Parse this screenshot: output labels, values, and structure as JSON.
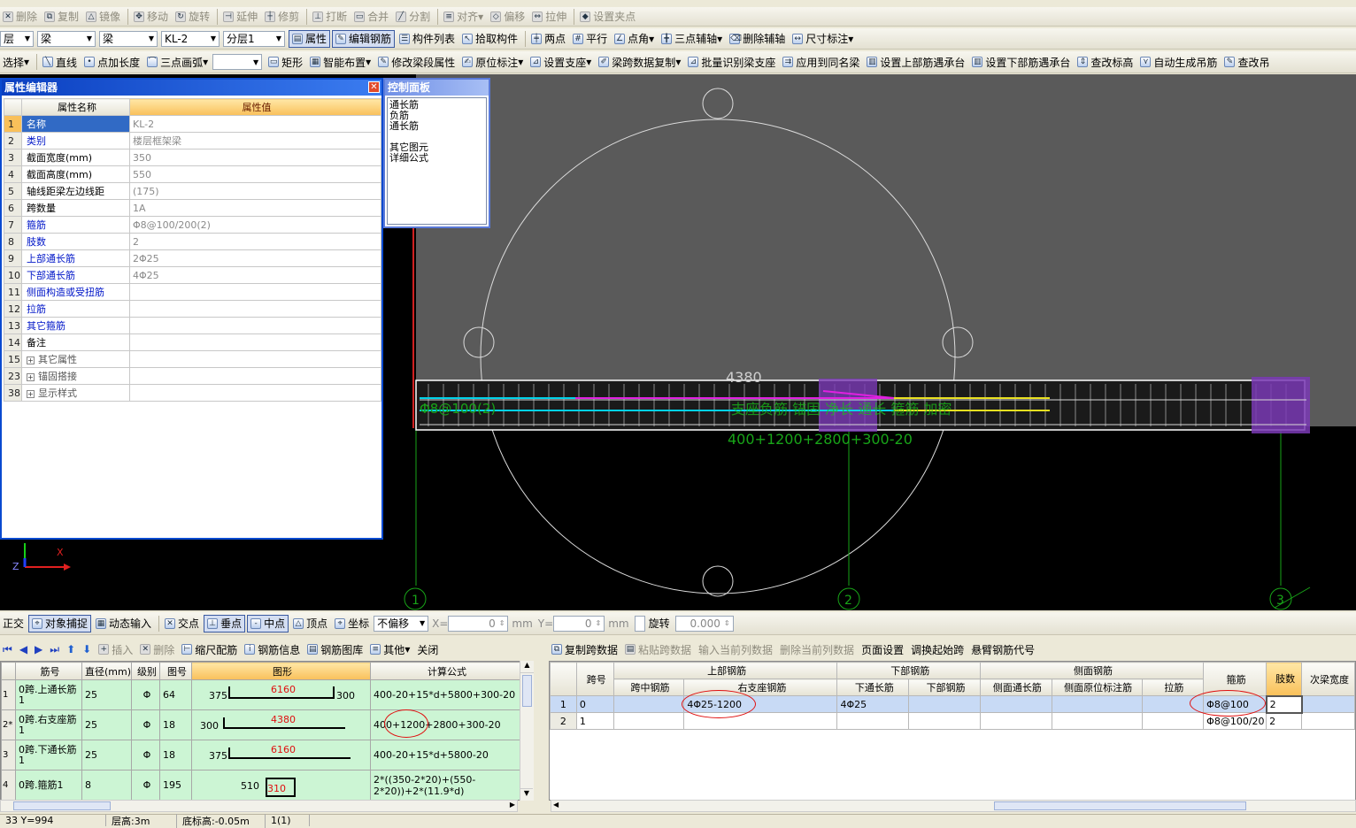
{
  "toolbar1": {
    "items": [
      "删除",
      "复制",
      "镜像",
      "移动",
      "旋转",
      "延伸",
      "修剪",
      "打断",
      "合并",
      "分割",
      "对齐",
      "偏移",
      "拉伸",
      "设置夹点"
    ]
  },
  "toolbar2": {
    "floor_combo": "层",
    "type_combo1": "梁",
    "type_combo2": "梁",
    "element_combo": "KL-2",
    "layer_combo": "分层1",
    "items": [
      "属性",
      "编辑钢筋",
      "构件列表",
      "拾取构件",
      "两点",
      "平行",
      "点角",
      "三点辅轴",
      "删除辅轴",
      "尺寸标注"
    ]
  },
  "toolbar3": {
    "select_label": "选择",
    "items": [
      "直线",
      "点加长度",
      "三点画弧",
      "矩形",
      "智能布置",
      "修改梁段属性",
      "原位标注",
      "设置支座",
      "梁跨数据复制",
      "批量识别梁支座",
      "应用到同名梁",
      "设置上部筋遇承台",
      "设置下部筋遇承台",
      "查改标高",
      "自动生成吊筋",
      "查改吊"
    ]
  },
  "property_editor": {
    "title": "属性编辑器",
    "col_name": "属性名称",
    "col_value": "属性值",
    "rows": [
      {
        "num": "1",
        "name": "名称",
        "value": "KL-2"
      },
      {
        "num": "2",
        "name": "类别",
        "value": "楼层框架梁"
      },
      {
        "num": "3",
        "name": "截面宽度(mm)",
        "value": "350"
      },
      {
        "num": "4",
        "name": "截面高度(mm)",
        "value": "550"
      },
      {
        "num": "5",
        "name": "轴线距梁左边线距",
        "value": "(175)"
      },
      {
        "num": "6",
        "name": "跨数量",
        "value": "1A"
      },
      {
        "num": "7",
        "name": "箍筋",
        "value": "Φ8@100/200(2)"
      },
      {
        "num": "8",
        "name": "肢数",
        "value": "2"
      },
      {
        "num": "9",
        "name": "上部通长筋",
        "value": "2Φ25"
      },
      {
        "num": "10",
        "name": "下部通长筋",
        "value": "4Φ25"
      },
      {
        "num": "11",
        "name": "侧面构造或受扭筋",
        "value": ""
      },
      {
        "num": "12",
        "name": "拉筋",
        "value": ""
      },
      {
        "num": "13",
        "name": "其它箍筋",
        "value": ""
      },
      {
        "num": "14",
        "name": "备注",
        "value": ""
      },
      {
        "num": "15",
        "name": "其它属性",
        "value": ""
      },
      {
        "num": "23",
        "name": "锚固搭接",
        "value": ""
      },
      {
        "num": "38",
        "name": "显示样式",
        "value": ""
      }
    ]
  },
  "control_panel": {
    "title": "控制面板",
    "lines": [
      "通长筋",
      "负筋",
      "通长筋",
      "",
      "其它图元",
      "详细公式"
    ]
  },
  "canvas": {
    "dim_top": "4380",
    "left_label": "Φ8@100(2)",
    "overlay_text": "支座负筋 锚固 净长 通长 箍筋 加密",
    "formula_text": "400+1200+2800+300-20",
    "axis_labels": [
      "1",
      "2",
      "3"
    ],
    "axes": {
      "x": "X",
      "y": "Y",
      "z": "Z"
    }
  },
  "snapbar": {
    "items": [
      "正交",
      "对象捕捉",
      "动态输入",
      "交点",
      "垂点",
      "中点",
      "顶点",
      "坐标"
    ],
    "offset_combo": "不偏移",
    "x_label": "X=",
    "x_value": "0",
    "y_label": "Y=",
    "y_value": "0",
    "unit": "mm",
    "rotate_label": "旋转",
    "rotate_value": "0.000"
  },
  "rebar_toolbar": {
    "items": [
      "插入",
      "删除",
      "缩尺配筋",
      "钢筋信息",
      "钢筋图库",
      "其他",
      "关闭"
    ]
  },
  "rebar_table": {
    "headers": [
      "筋号",
      "直径(mm)",
      "级别",
      "图号",
      "图形",
      "计算公式"
    ],
    "rows": [
      {
        "rn": "1",
        "name": "0跨.上通长筋1",
        "dia": "25",
        "grade": "Φ",
        "fig": "64",
        "shape_left": "375",
        "shape_mid": "6160",
        "shape_right": "300",
        "formula": "400-20+15*d+5800+300-20"
      },
      {
        "rn": "2*",
        "name": "0跨.右支座筋1",
        "dia": "25",
        "grade": "Φ",
        "fig": "18",
        "shape_left": "300",
        "shape_mid": "4380",
        "shape_right": "",
        "formula": "400+1200+2800+300-20"
      },
      {
        "rn": "3",
        "name": "0跨.下通长筋1",
        "dia": "25",
        "grade": "Φ",
        "fig": "18",
        "shape_left": "375",
        "shape_mid": "6160",
        "shape_right": "",
        "formula": "400-20+15*d+5800-20"
      },
      {
        "rn": "4",
        "name": "0跨.箍筋1",
        "dia": "8",
        "grade": "Φ",
        "fig": "195",
        "shape_left": "510",
        "shape_mid": "310",
        "shape_right": "",
        "formula": "2*((350-2*20)+(550-2*20))+2*(11.9*d)"
      }
    ]
  },
  "span_toolbar": {
    "items": [
      "复制跨数据",
      "粘贴跨数据",
      "输入当前列数据",
      "删除当前列数据",
      "页面设置",
      "调换起始跨",
      "悬臂钢筋代号"
    ]
  },
  "span_table": {
    "group_headers": [
      "上部钢筋",
      "下部钢筋",
      "侧面钢筋"
    ],
    "col_span": "跨号",
    "top_cols": [
      "跨中钢筋",
      "右支座钢筋"
    ],
    "bottom_cols": [
      "下通长筋",
      "下部钢筋"
    ],
    "side_cols": [
      "侧面通长筋",
      "侧面原位标注筋",
      "拉筋"
    ],
    "col_stirrup": "箍筋",
    "col_legs": "肢数",
    "col_sub": "次梁宽度",
    "rows": [
      {
        "rn": "1",
        "span": "0",
        "mid": "",
        "right": "4Φ25-1200",
        "bot_through": "4Φ25",
        "bot": "",
        "side_through": "",
        "side_loc": "",
        "tie": "",
        "stirrup": "Φ8@100",
        "legs": "2"
      },
      {
        "rn": "2",
        "span": "1",
        "mid": "",
        "right": "",
        "bot_through": "",
        "bot": "",
        "side_through": "",
        "side_loc": "",
        "tie": "",
        "stirrup": "Φ8@100/20",
        "legs": "2"
      }
    ]
  },
  "status": {
    "coords": "33 Y=994",
    "floor_height": "层高:3m",
    "base_elev": "底标高:-0.05m",
    "count": "1(1)"
  },
  "colors": {
    "canvas_bg": "#000000",
    "canvas_gray": "#5a5a5a",
    "selection_blue": "#316ac5",
    "accent_orange": "#f9c05a",
    "grid_green": "#ccf5d4"
  }
}
